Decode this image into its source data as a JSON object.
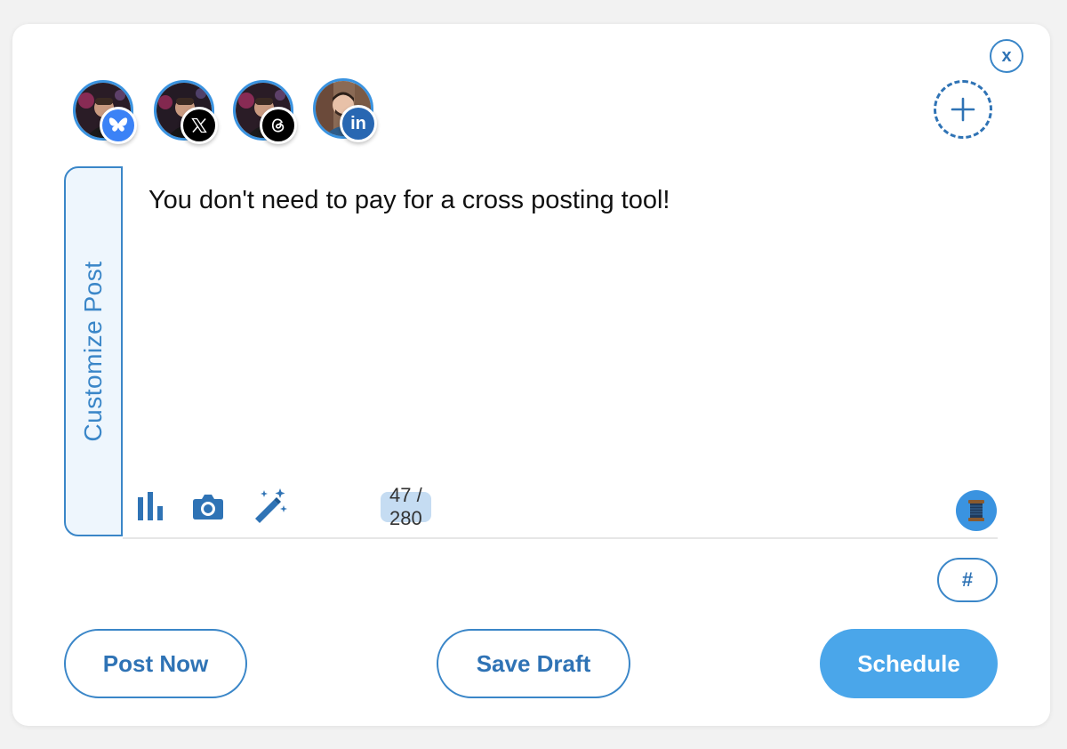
{
  "close_label": "x",
  "accounts": [
    {
      "platform": "Bluesky",
      "badge_icon": "butterfly-icon",
      "badge_color": "#3b82f6"
    },
    {
      "platform": "X",
      "badge_icon": "x-logo-icon",
      "badge_color": "#000000"
    },
    {
      "platform": "Threads",
      "badge_icon": "threads-logo-icon",
      "badge_color": "#000000"
    },
    {
      "platform": "LinkedIn",
      "badge_icon": "linkedin-logo-icon",
      "badge_color": "#2867b2"
    }
  ],
  "editor": {
    "customize_tab_label": "Customize Post",
    "post_text": "You don't need to pay for a cross posting tool!",
    "char_counter": "47 / 280",
    "tools": [
      "poll-icon",
      "camera-icon",
      "magic-wand-icon"
    ]
  },
  "hashtag_label": "#",
  "buttons": {
    "post_now": "Post Now",
    "save_draft": "Save Draft",
    "schedule": "Schedule"
  },
  "colors": {
    "accent": "#3a86c8",
    "primary_button": "#4aa6ea",
    "tab_background": "#eef6fd",
    "counter_background": "#c5dcf2"
  }
}
